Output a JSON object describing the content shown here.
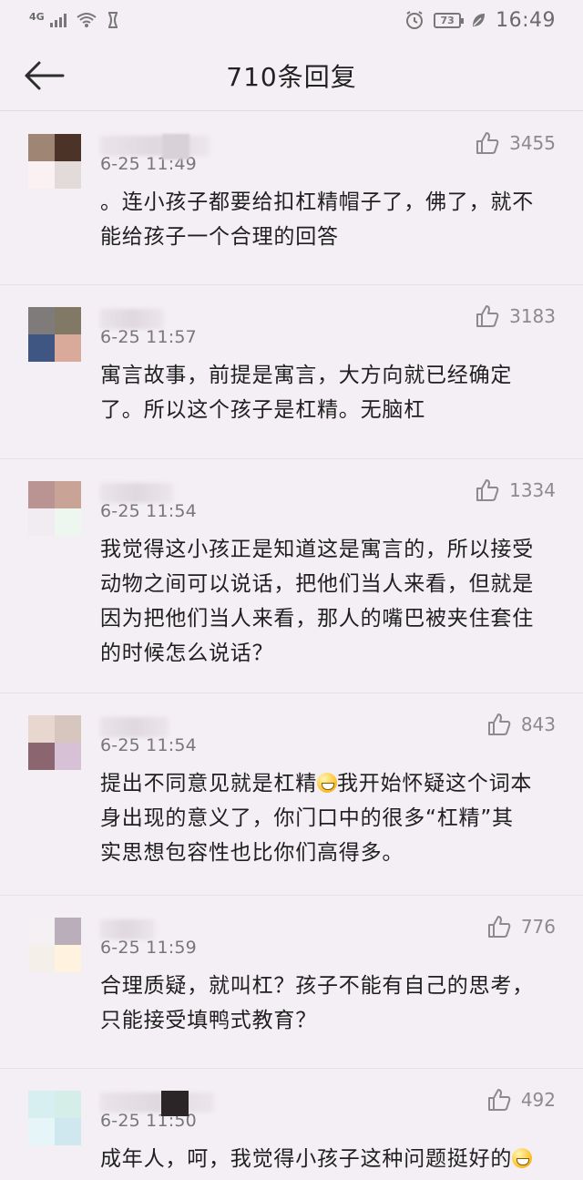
{
  "status_bar": {
    "network": "4G",
    "battery": "73",
    "time": "16:49"
  },
  "header": {
    "title": "710条回复",
    "back_icon": "arrow-left-icon"
  },
  "comments": [
    {
      "likes": "3455",
      "time": "6-25  11:49",
      "content": "。连小孩子都要给扣杠精帽子了，佛了，就不\n能给孩子一个合理的回答",
      "avatar_colors": [
        "#9f8574",
        "#4b3427",
        "#fbf0f2",
        "#e2dbd9"
      ]
    },
    {
      "likes": "3183",
      "time": "6-25  11:57",
      "content": "寓言故事，前提是寓言，大方向就已经确定\n了。所以这个孩子是杠精。无脑杠",
      "avatar_colors": [
        "#7e7b7a",
        "#817965",
        "#3f5683",
        "#d9aa9a"
      ]
    },
    {
      "likes": "1334",
      "time": "6-25  11:54",
      "content": "我觉得这小孩正是知道这是寓言的，所以接受\n动物之间可以说话，把他们当人来看，但就是\n因为把他们当人来看，那人的嘴巴被夹住套住\n的时候怎么说话？",
      "avatar_colors": [
        "#b99493",
        "#c9a396",
        "#f1ebf2",
        "#eef6f0"
      ]
    },
    {
      "likes": "843",
      "time": "6-25  11:54",
      "content_before_emoji": "提出不同意见就是杠精",
      "emoji": "grinning-emoji-icon",
      "content_after_emoji": "我开始怀疑这个词本\n身出现的意义了，你门口中的很多“杠精”其\n实思想包容性也比你们高得多。",
      "avatar_colors": [
        "#e8d7cf",
        "#d7c6bd",
        "#8b6570",
        "#d6c1d7"
      ]
    },
    {
      "likes": "776",
      "time": "6-25  11:59",
      "content": "合理质疑，就叫杠？孩子不能有自己的思考，\n只能接受填鸭式教育？",
      "avatar_colors": [
        "#f4f0f4",
        "#b9aeb9",
        "#f5efea",
        "#fff3df"
      ]
    },
    {
      "likes": "492",
      "time": "6-25  11:50",
      "content_before_emoji": "成年人，呵，我觉得小孩子这种问题挺好的",
      "emoji": "grinning-emoji-icon",
      "content_after_emoji": "",
      "avatar_colors": [
        "#d7eff0",
        "#d5eee8",
        "#e6f6f8",
        "#cfe7ef"
      ]
    }
  ]
}
